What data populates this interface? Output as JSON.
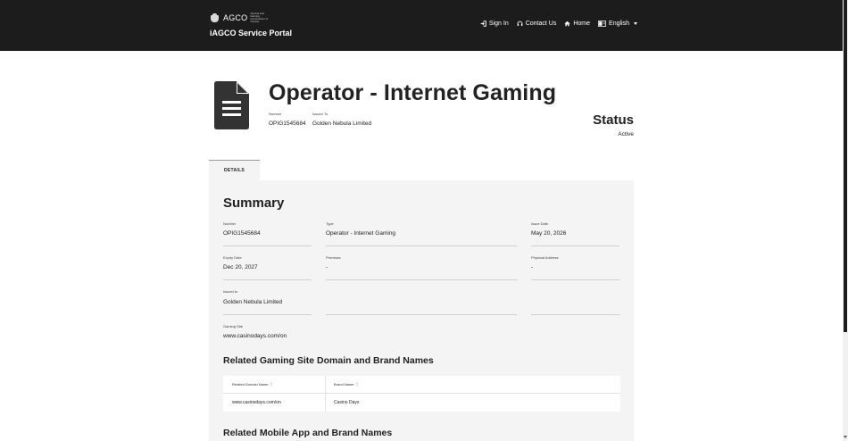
{
  "header": {
    "agency": "AGCO",
    "agency_subtitle": "Alcohol and Gaming Commission of Ontario",
    "portal_title": "iAGCO Service Portal",
    "nav": {
      "sign_in": "Sign In",
      "contact_us": "Contact Us",
      "home": "Home",
      "language": "English"
    }
  },
  "licence": {
    "title": "Operator - Internet Gaming",
    "number_label": "Number",
    "number": "OPIG1545684",
    "issued_to_label": "Issued To",
    "issued_to": "Golden Nebula Limited",
    "status_heading": "Status",
    "status": "Active"
  },
  "tabs": {
    "details": "DETAILS"
  },
  "summary": {
    "heading": "Summary",
    "fields": {
      "number": {
        "label": "Number",
        "value": "OPIG1545684"
      },
      "type": {
        "label": "Type",
        "value": "Operator - Internet Gaming"
      },
      "issue_date": {
        "label": "Issue Date",
        "value": "May 20, 2026"
      },
      "expiry_date": {
        "label": "Expiry Date",
        "value": "Dec 20, 2027"
      },
      "premises": {
        "label": "Premises",
        "value": "-"
      },
      "physical_address": {
        "label": "Physical Address",
        "value": "-"
      },
      "issued_to": {
        "label": "Issued to",
        "value": "Golden Nebula Limited"
      },
      "gaming_site": {
        "label": "Gaming Site",
        "value": "www.casinodays.com/on"
      }
    }
  },
  "related_domains": {
    "heading": "Related Gaming Site Domain and Brand Names",
    "columns": [
      "Related Domain Name",
      "Brand Name"
    ],
    "rows": [
      [
        "www.casinodays.com/on",
        "Casino Days"
      ]
    ]
  },
  "related_apps": {
    "heading": "Related Mobile App and Brand Names"
  }
}
